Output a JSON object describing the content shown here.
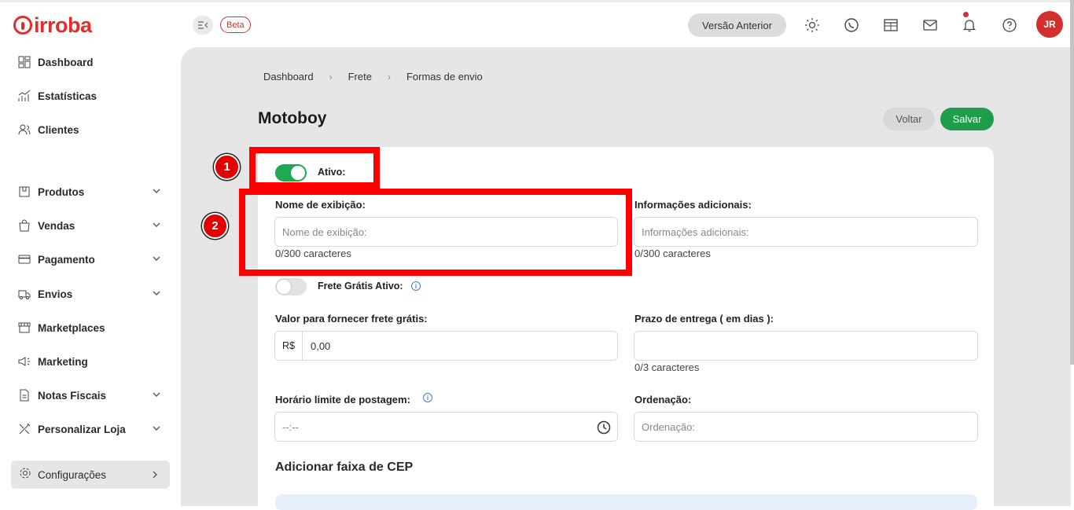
{
  "brand": {
    "name": "irroba",
    "color": "#e32d2d"
  },
  "header": {
    "beta_label": "Beta",
    "prev_version_label": "Versão Anterior",
    "avatar_initials": "JR",
    "icons": [
      "sun-icon",
      "whatsapp-icon",
      "calendar-icon",
      "mail-icon",
      "bell-icon",
      "help-icon"
    ]
  },
  "sidebar": {
    "items": [
      {
        "label": "Dashboard",
        "icon": "dashboard-icon",
        "has_chevron": false
      },
      {
        "label": "Estatísticas",
        "icon": "stats-icon",
        "has_chevron": false
      },
      {
        "label": "Clientes",
        "icon": "users-icon",
        "has_chevron": false
      },
      {
        "label": "Produtos",
        "icon": "products-icon",
        "has_chevron": true
      },
      {
        "label": "Vendas",
        "icon": "bag-icon",
        "has_chevron": true
      },
      {
        "label": "Pagamento",
        "icon": "card-icon",
        "has_chevron": true
      },
      {
        "label": "Envios",
        "icon": "truck-icon",
        "has_chevron": true
      },
      {
        "label": "Marketplaces",
        "icon": "store-icon",
        "has_chevron": false
      },
      {
        "label": "Marketing",
        "icon": "megaphone-icon",
        "has_chevron": false
      },
      {
        "label": "Notas Fiscais",
        "icon": "invoice-icon",
        "has_chevron": true
      },
      {
        "label": "Personalizar Loja",
        "icon": "tools-icon",
        "has_chevron": true
      }
    ],
    "settings_label": "Configurações"
  },
  "breadcrumb": [
    "Dashboard",
    "Frete",
    "Formas de envio"
  ],
  "page": {
    "title": "Motoboy",
    "back_label": "Voltar",
    "save_label": "Salvar"
  },
  "form": {
    "active_label": "Ativo:",
    "active_on": true,
    "display_name_label": "Nome de exibição:",
    "display_name_placeholder": "Nome de exibição:",
    "display_name_counter": "0/300 caracteres",
    "extra_info_label": "Informações adicionais:",
    "extra_info_placeholder": "Informações adicionais:",
    "extra_info_counter": "0/300 caracteres",
    "free_shipping_label": "Frete Grátis Ativo:",
    "free_shipping_on": false,
    "free_value_label": "Valor para fornecer frete grátis:",
    "currency_prefix": "R$",
    "free_value": "0,00",
    "delivery_days_label": "Prazo de entrega ( em dias ):",
    "delivery_days_counter": "0/3 caracteres",
    "post_time_label": "Horário limite de postagem:",
    "post_time_placeholder": "--:--",
    "order_label": "Ordenação:",
    "order_placeholder": "Ordenação:",
    "cep_section_title": "Adicionar faixa de CEP"
  },
  "annotations": {
    "badge_1": "1",
    "badge_2": "2",
    "highlight_color": "#ff0000"
  },
  "colors": {
    "accent_green": "#1e9e4a",
    "brand_red": "#d32f2f",
    "info_blue": "#3b7dd8"
  }
}
